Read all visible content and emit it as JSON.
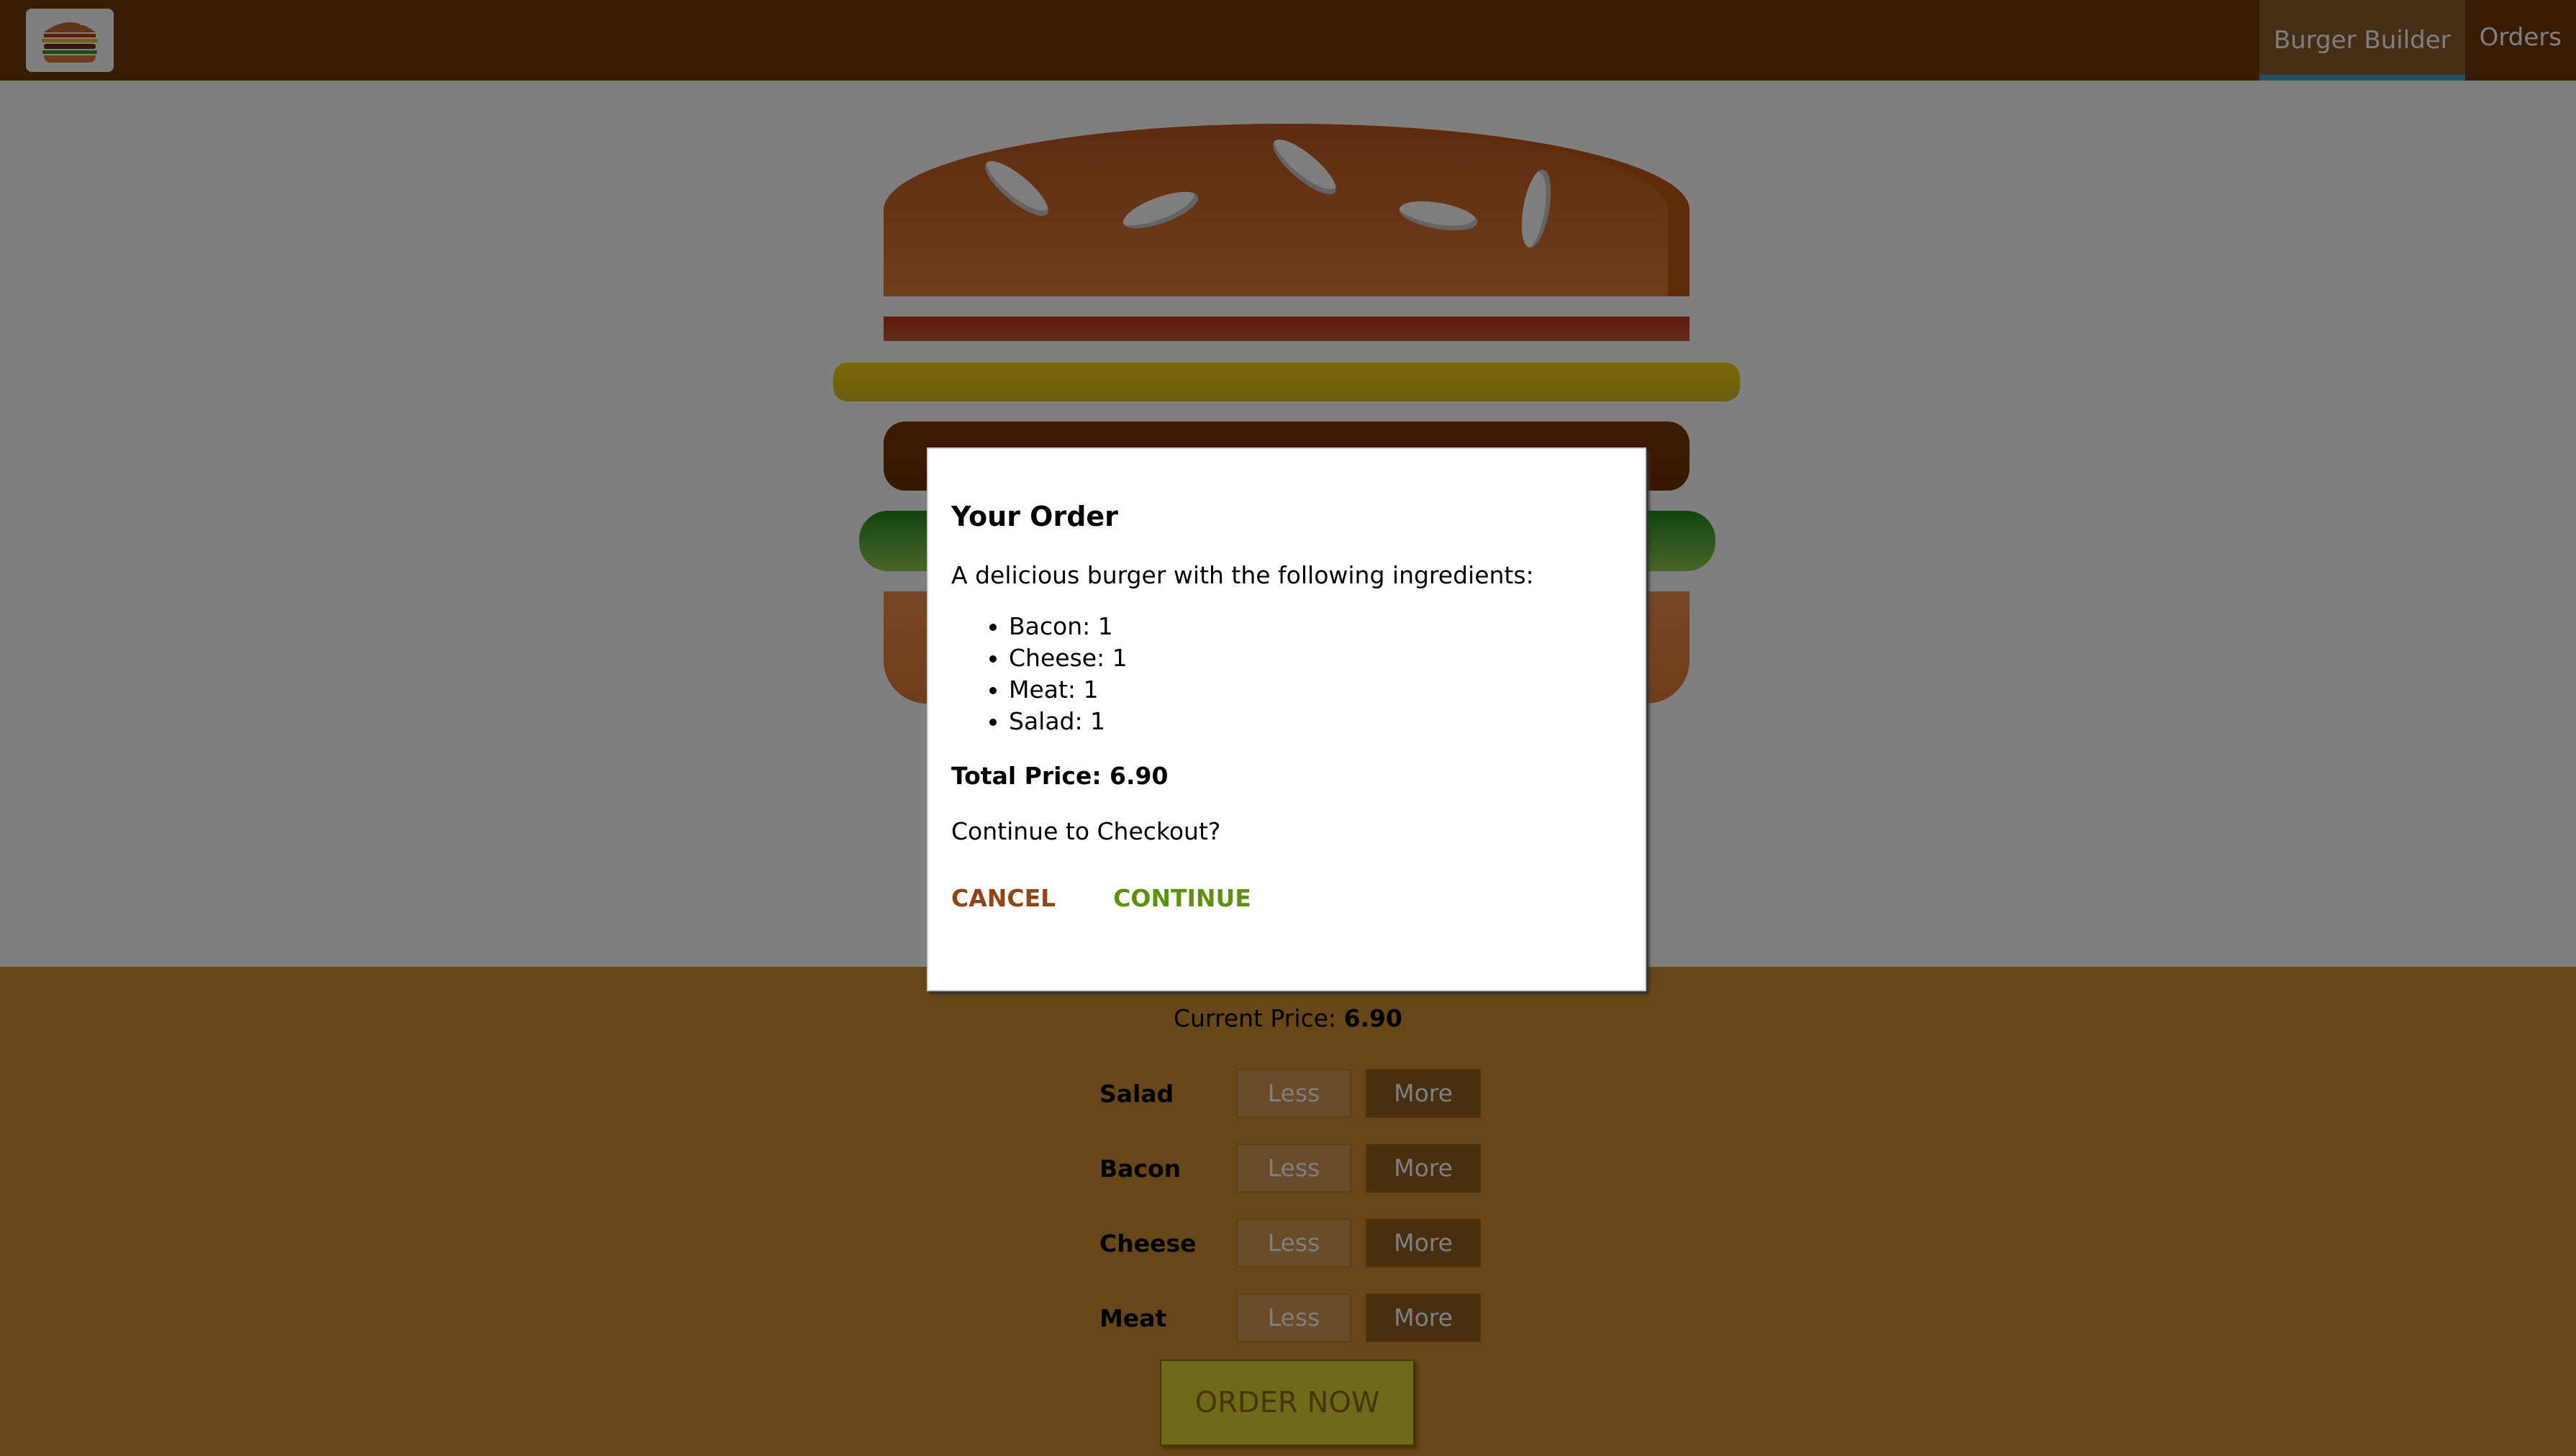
{
  "toolbar": {
    "logo_icon": "burger-logo-icon",
    "nav": [
      {
        "label": "Burger Builder",
        "active": true
      },
      {
        "label": "Orders",
        "active": false
      }
    ]
  },
  "build_controls": {
    "current_price_label": "Current Price:",
    "current_price_value": "6.90",
    "less_label": "Less",
    "more_label": "More",
    "items": [
      {
        "label": "Salad"
      },
      {
        "label": "Bacon"
      },
      {
        "label": "Cheese"
      },
      {
        "label": "Meat"
      }
    ],
    "order_label": "ORDER NOW"
  },
  "modal": {
    "title": "Your Order",
    "intro": "A delicious burger with the following ingredients:",
    "ingredients": [
      {
        "text": "Bacon: 1"
      },
      {
        "text": "Cheese: 1"
      },
      {
        "text": "Meat: 1"
      },
      {
        "text": "Salad: 1"
      }
    ],
    "total_label": "Total Price: 6.90",
    "question": "Continue to Checkout?",
    "cancel_label": "CANCEL",
    "continue_label": "CONTINUE"
  },
  "colors": {
    "toolbar": "#703B09",
    "controls_bg": "#CF8F2E",
    "active_nav_border": "#40A4C8",
    "cancel": "#944317",
    "continue": "#5C9210"
  }
}
